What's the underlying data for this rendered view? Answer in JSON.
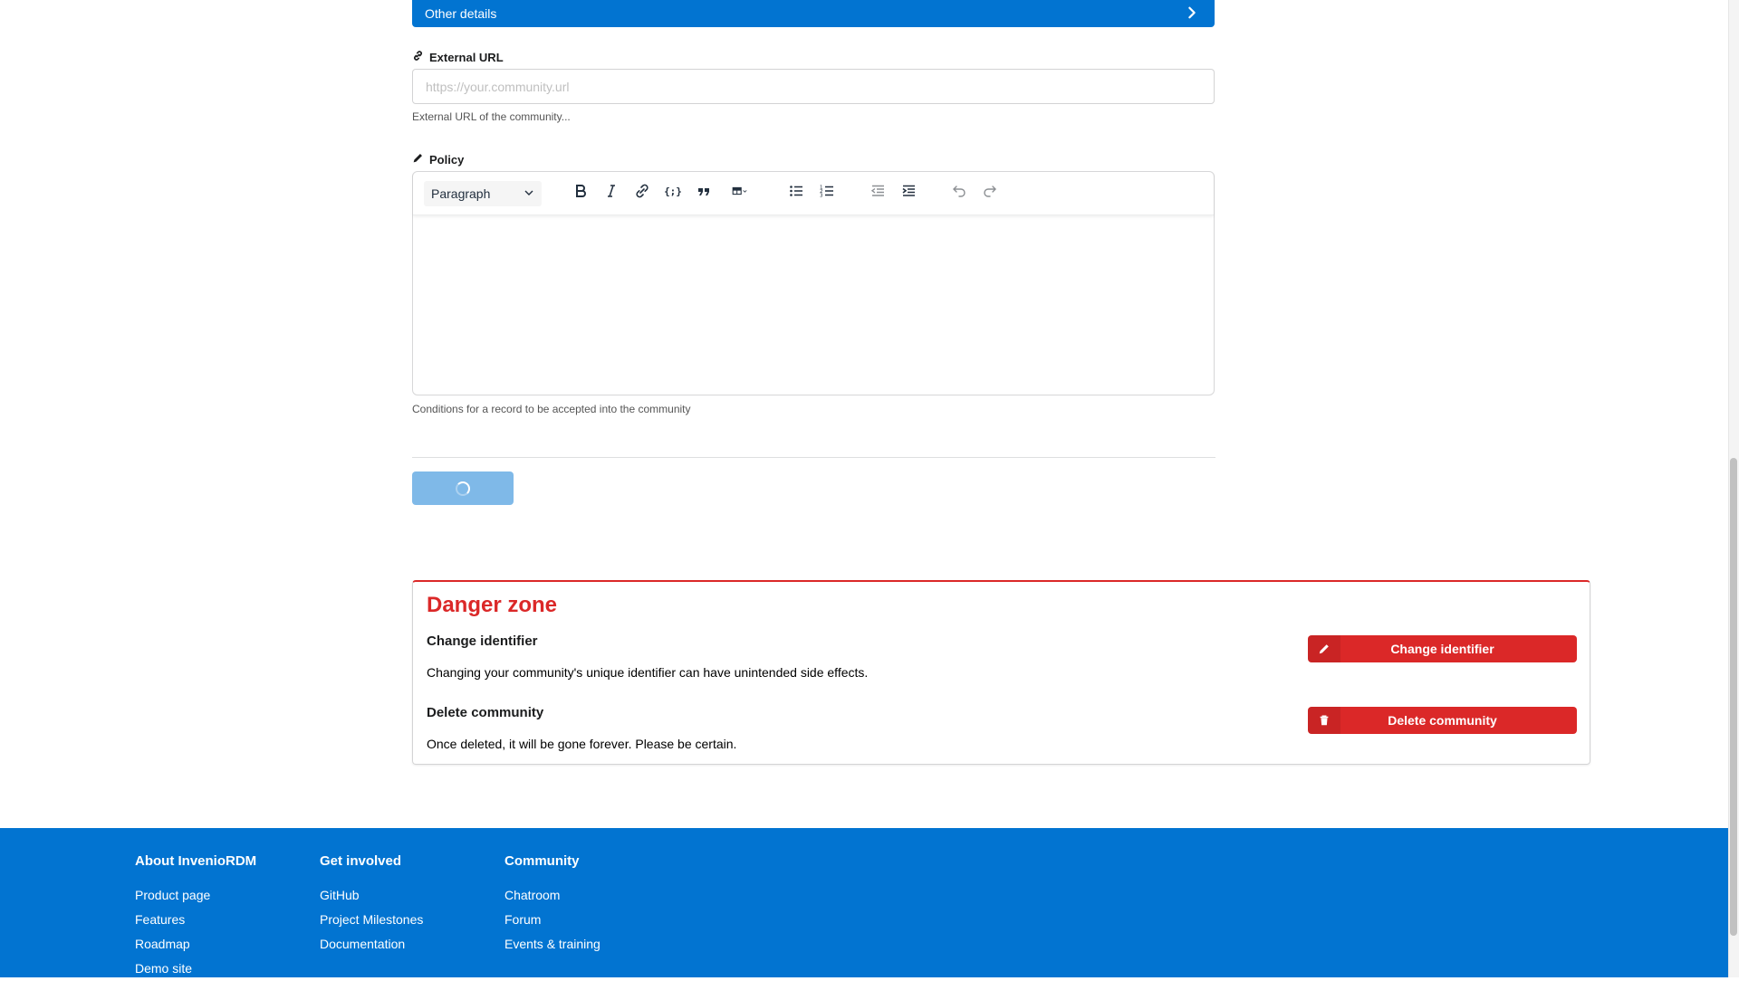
{
  "accordion": {
    "title": "Other details"
  },
  "external_url": {
    "label": "External URL",
    "placeholder": "https://your.community.url",
    "value": "",
    "help": "External URL of the community..."
  },
  "policy": {
    "label": "Policy",
    "block_format": "Paragraph",
    "help": "Conditions for a record to be accepted into the community",
    "toolbar_icons": [
      "bold-icon",
      "italic-icon",
      "link-icon",
      "code-icon",
      "blockquote-icon",
      "table-icon",
      "bullet-list-icon",
      "numbered-list-icon",
      "outdent-icon",
      "indent-icon",
      "undo-icon",
      "redo-icon"
    ]
  },
  "save": {
    "state": "loading"
  },
  "danger_zone": {
    "title": "Danger zone",
    "change_identifier": {
      "title": "Change identifier",
      "description": "Changing your community's unique identifier can have unintended side effects.",
      "button": "Change identifier"
    },
    "delete_community": {
      "title": "Delete community",
      "description": "Once deleted, it will be gone forever. Please be certain.",
      "button": "Delete community"
    }
  },
  "footer": {
    "columns": [
      {
        "heading": "About InvenioRDM",
        "links": [
          "Product page",
          "Features",
          "Roadmap",
          "Demo site"
        ]
      },
      {
        "heading": "Get involved",
        "links": [
          "GitHub",
          "Project Milestones",
          "Documentation"
        ]
      },
      {
        "heading": "Community",
        "links": [
          "Chatroom",
          "Forum",
          "Events & training"
        ]
      }
    ]
  },
  "colors": {
    "primary": "#0274d1",
    "danger": "#db2828",
    "save_disabled": "#7fb9e8"
  }
}
